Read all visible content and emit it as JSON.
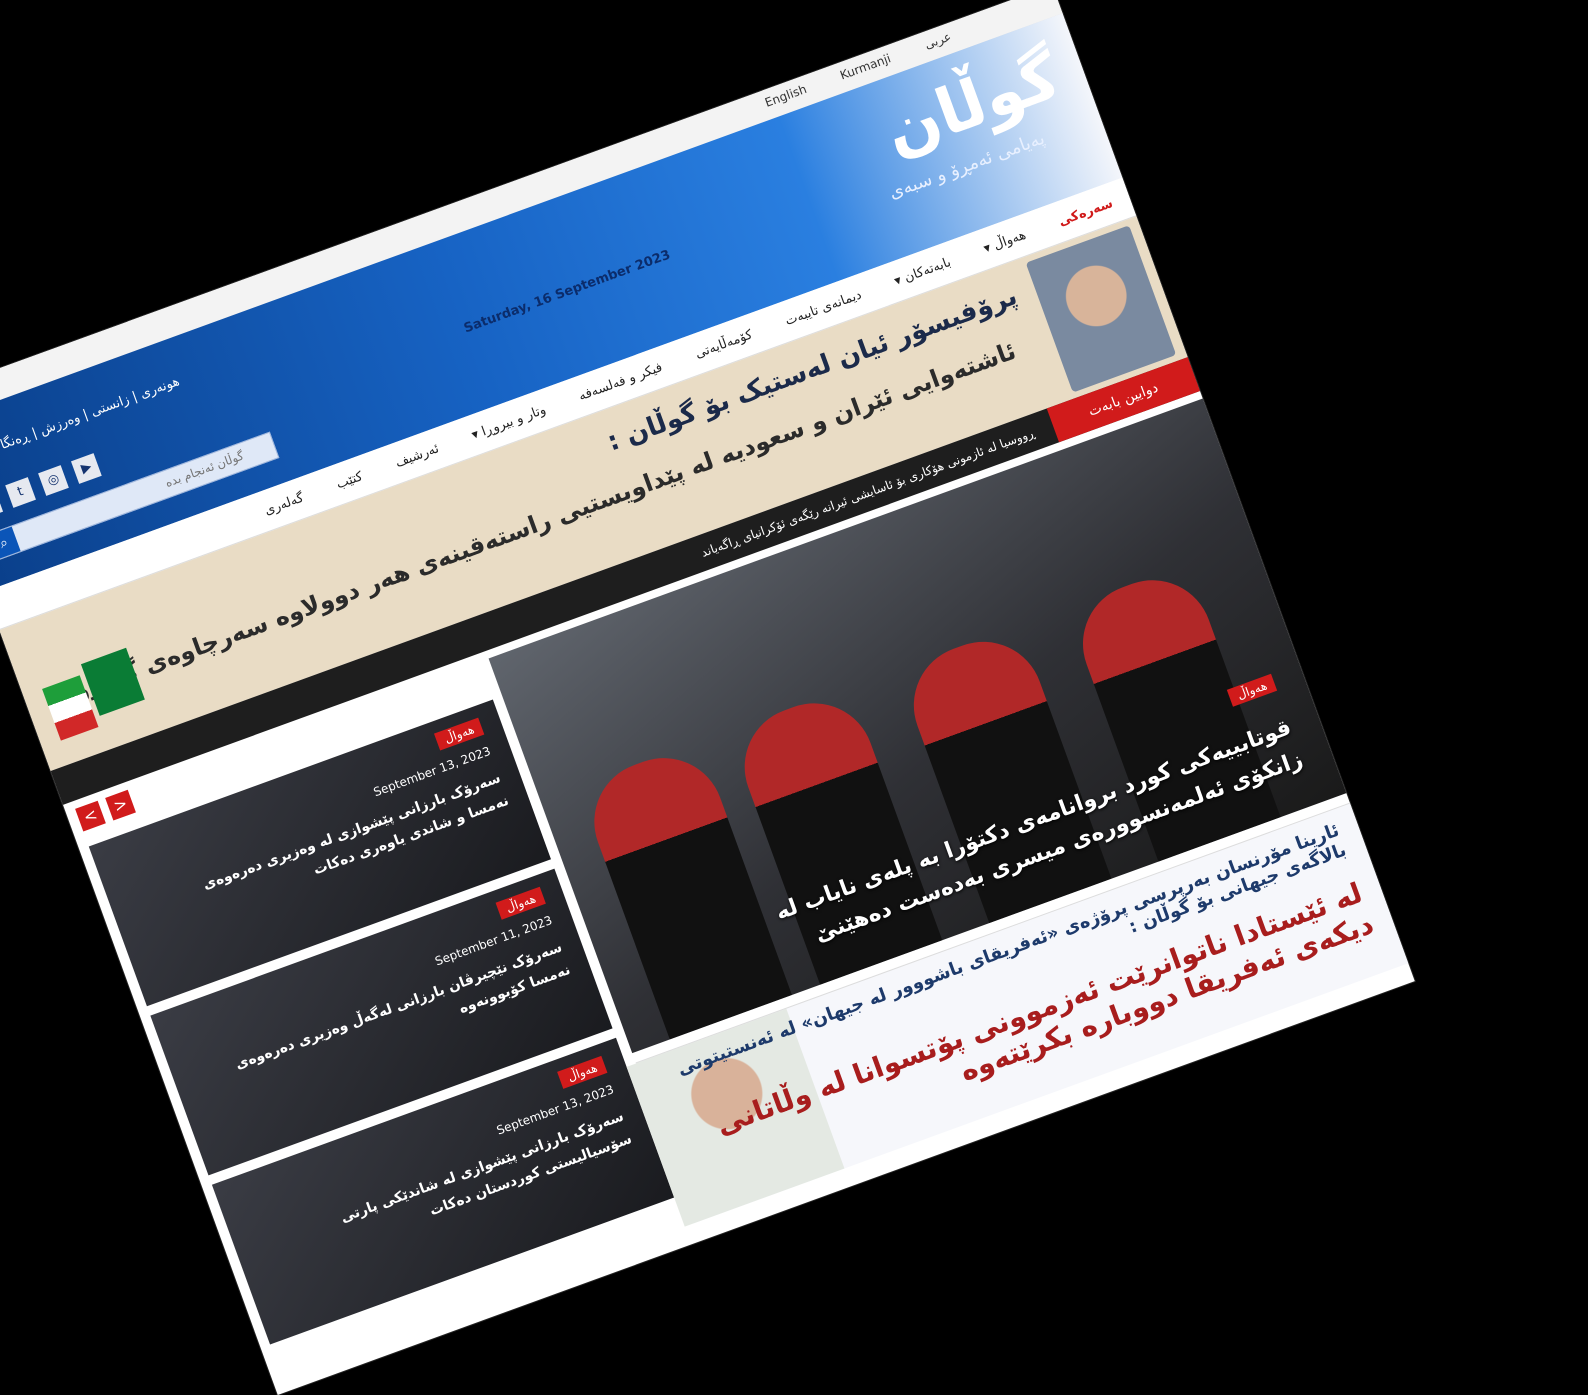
{
  "top_bar": {
    "languages": [
      "English",
      "Kurmanji",
      "عربی"
    ]
  },
  "header": {
    "logo": "گوڵان",
    "tagline": "پەیامی ئەمڕۆ و سبەی",
    "date": "Saturday, 16 September 2023",
    "categories": "هونەری | زانستی | وەرزش | ڕەنگا و ڕەنگ",
    "search": {
      "placeholder": "گوڵان ئەنجام بدە",
      "icon": "search-icon"
    },
    "social_icons": [
      "facebook-icon",
      "twitter-icon",
      "instagram-icon",
      "youtube-icon"
    ]
  },
  "nav": {
    "items": [
      {
        "label": "سەرەکی",
        "active": true
      },
      {
        "label": "هەواڵ ▾",
        "active": false
      },
      {
        "label": "بابەتەکان ▾",
        "active": false
      },
      {
        "label": "دیمانەی تایبەت",
        "active": false
      },
      {
        "label": "کۆمەڵایەتی",
        "active": false
      },
      {
        "label": "فیکر و فەلسەفە",
        "active": false
      },
      {
        "label": "وتار و بیروڕا ▾",
        "active": false
      },
      {
        "label": "ئەرشیف",
        "active": false
      },
      {
        "label": "کتێب",
        "active": false
      },
      {
        "label": "گەلەری",
        "active": false
      }
    ]
  },
  "top_banner": {
    "headline": "پرۆفیسۆر ئیان لەستیک بۆ گوڵان :",
    "subheadline": "ئاشتەوایی ئێران و سعودیە لە پێداویستیی راستەقینەی هەر دوولاوە سەرچاوەی گرتووە"
  },
  "breaking": {
    "label": "دوایین بابەت",
    "text": "ڕووسیا لە ئازمونی هۆکاری بۆ ئاسایشی ئیرانە رێگەی ئۆکرانیای ڕاگەیاند"
  },
  "feature": {
    "badge": "هەواڵ",
    "title": "قوتابییەکی کورد بروانامەی دکتۆرا بە پلەی نایاب لە زانکۆی ئەلمەنسوورەی میسری بەدەست دەهێنێ"
  },
  "sidebar": {
    "arrows": [
      "<",
      ">"
    ],
    "items": [
      {
        "badge": "هەواڵ",
        "date": "September 13, 2023",
        "title": "سەرۆک بارزانی پێشوازی لە وەزیری دەرەوەی نەمسا و شاندی یاوەری دەکات"
      },
      {
        "badge": "هەواڵ",
        "date": "September 11, 2023",
        "title": "سەرۆک نێچیرڤان بارزانی لەگەڵ وەزیری دەرەوەی نەمسا کۆبوونەوە"
      },
      {
        "badge": "هەواڵ",
        "date": "September 13, 2023",
        "title": "سەرۆک بارزانی پێشوازی لە شاندێکی پارتی سۆسیالیستی کوردستان دەکات"
      }
    ]
  },
  "ad_banner": {
    "line1": "ئارینا مۆرنسان بەرپرسی پرۆژەی «ئەفریقای باشووور لە جیهان» لە ئەنستیتوتی بالاگەی جیهانی بۆ گوڵان :",
    "line2": "لە ئێستادا ناتوانرێت ئەزموونی پۆتسوانا لە وڵاتانی دیکەی ئەفریقا دووبارە بکرێتەوە"
  }
}
